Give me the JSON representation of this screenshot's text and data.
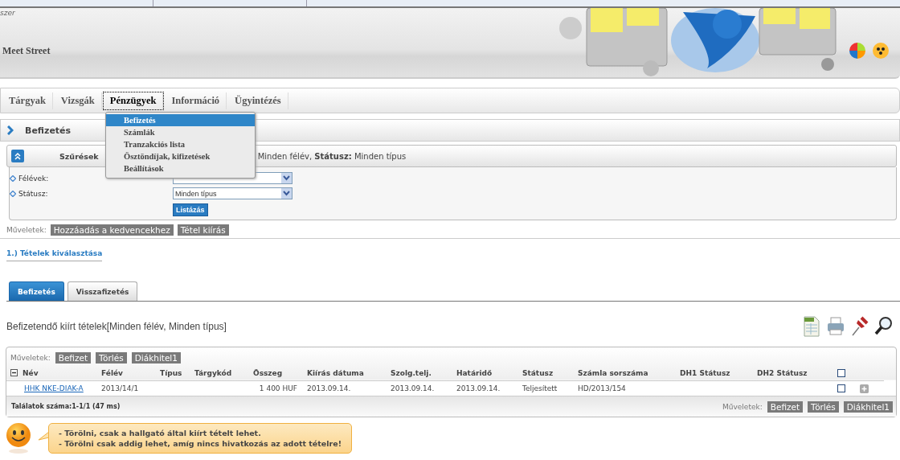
{
  "header": {
    "subtitle": "szer",
    "title": "Meet Street"
  },
  "nav": [
    {
      "label": "Tárgyak",
      "selected": false
    },
    {
      "label": "Vizsgák",
      "selected": false
    },
    {
      "label": "Pénzügyek",
      "selected": true
    },
    {
      "label": "Információ",
      "selected": false
    },
    {
      "label": "Ügyintézés",
      "selected": false
    }
  ],
  "menu": [
    {
      "label": "Befizetés",
      "selected": true
    },
    {
      "label": "Számlák",
      "selected": false
    },
    {
      "label": "Tranzakciós lista",
      "selected": false
    },
    {
      "label": "Ösztöndíjak, kifizetések",
      "selected": false
    },
    {
      "label": "Beállítások",
      "selected": false
    }
  ],
  "page_title": "Befizetés",
  "filter": {
    "title": "Szűrések",
    "summary": "Minden félév, **Státusz:** Minden típus",
    "fields": [
      {
        "label": "Félévek:"
      },
      {
        "label": "Státusz:",
        "value": "Minden típus"
      }
    ],
    "button": "Listázás"
  },
  "actions": {
    "label": "Műveletek:",
    "buttons": [
      "Hozzáadás a kedvencekhez",
      "Tétel kiírás"
    ]
  },
  "step_link": "1.) Tételek kiválasztása",
  "tabs": [
    {
      "label": "Befizetés",
      "selected": true
    },
    {
      "label": "Visszafizetés",
      "selected": false
    }
  ],
  "list_title": "Befizetendő kiírt tételek[Minden félév, Minden típus]",
  "table": {
    "actions_label": "Műveletek:",
    "actions": [
      "Befizet",
      "Törlés",
      "Diákhitel1"
    ],
    "columns": [
      "Név",
      "Félév",
      "Típus",
      "Tárgykód",
      "Összeg",
      "Kiírás dátuma",
      "Szolg.telj.",
      "Határidő",
      "Státusz",
      "Számla sorszáma",
      "DH1 Státusz",
      "DH2 Státusz"
    ],
    "header_checked": false,
    "rows": [
      {
        "cells": [
          "HHK NKE-DIAK-A",
          "2013/14/1",
          "",
          "",
          "1 400 HUF",
          "2013.09.14.",
          "2013.09.14.",
          "2013.09.14.",
          "Teljesített",
          "HD/2013/154",
          "",
          ""
        ],
        "checked": false
      }
    ],
    "count": "Találatok száma:1-1/1 (47 ms)",
    "footer_actions_label": "Műveletek:",
    "footer_actions": [
      "Befizet",
      "Törlés",
      "Diákhitel1"
    ]
  },
  "notes": [
    "- Törölni, csak a hallgató által kiírt tételt lehet.",
    "- Törölni csak addig lehet, amíg nincs hivatkozás az adott tételre!"
  ]
}
